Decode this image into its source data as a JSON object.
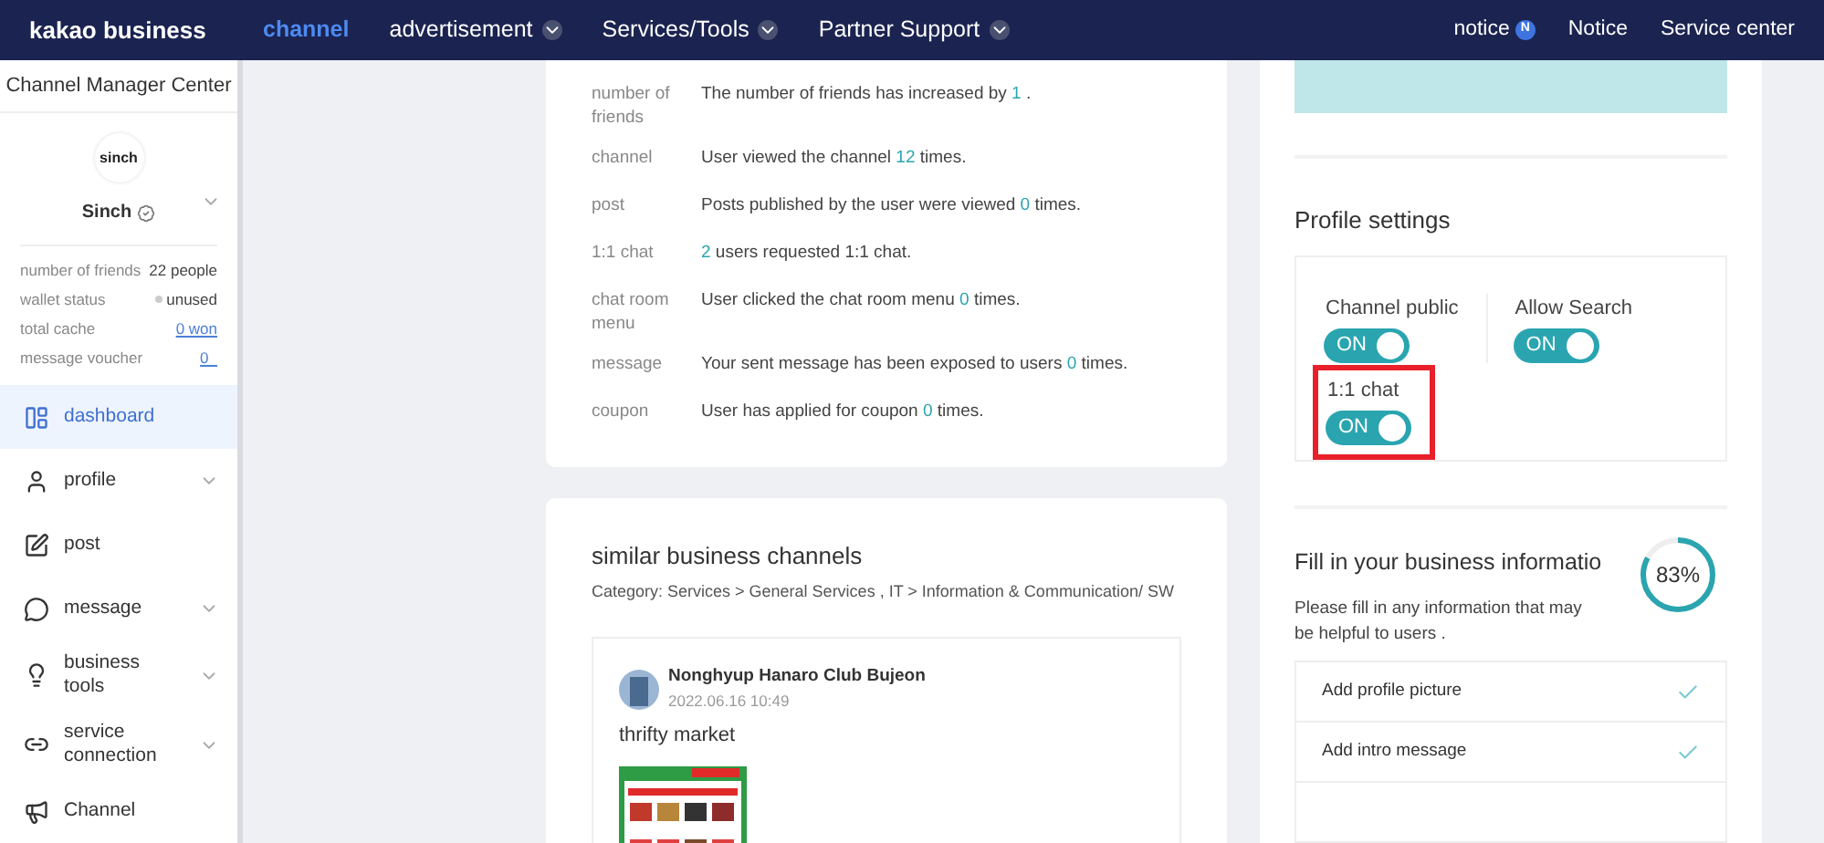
{
  "header": {
    "logo": "kakao business",
    "nav": [
      {
        "label": "channel",
        "selected": true,
        "dropdown": false
      },
      {
        "label": "advertisement",
        "selected": false,
        "dropdown": true
      },
      {
        "label": "Services/Tools",
        "selected": false,
        "dropdown": true
      },
      {
        "label": "Partner Support",
        "selected": false,
        "dropdown": true
      }
    ],
    "notice": {
      "label": "notice",
      "badge": "N"
    },
    "links": [
      "Notice",
      "Service center"
    ]
  },
  "sidebar": {
    "title": "Channel Manager Center",
    "channel": {
      "logo": "sinch",
      "name": "Sinch"
    },
    "stats": [
      {
        "label": "number of friends",
        "value": "22 people",
        "kind": "text"
      },
      {
        "label": "wallet status",
        "value": "unused",
        "kind": "status"
      },
      {
        "label": "total cache",
        "value": "0 won",
        "kind": "link"
      },
      {
        "label": "message voucher",
        "value": "0_",
        "kind": "link"
      }
    ],
    "items": [
      {
        "label": "dashboard",
        "selected": true,
        "dropdown": false
      },
      {
        "label": "profile",
        "selected": false,
        "dropdown": true
      },
      {
        "label": "post",
        "selected": false,
        "dropdown": false
      },
      {
        "label": "message",
        "selected": false,
        "dropdown": true
      },
      {
        "label": "business tools",
        "selected": false,
        "dropdown": true
      },
      {
        "label": "service connection",
        "selected": false,
        "dropdown": true
      },
      {
        "label": "Channel",
        "selected": false,
        "dropdown": false
      }
    ]
  },
  "activity": [
    {
      "label": "number of friends",
      "before": "The number of friends has increased by ",
      "number": "1",
      "after": " ."
    },
    {
      "label": "channel",
      "before": "User viewed the channel ",
      "number": "12",
      "after": " times."
    },
    {
      "label": "post",
      "before": "Posts published by the user were viewed ",
      "number": "0",
      "after": " times."
    },
    {
      "label": "1:1 chat",
      "number": "2",
      "after": " users requested 1:1 chat."
    },
    {
      "label": "chat room menu",
      "before": "User clicked the chat room menu ",
      "number": "0",
      "after": " times."
    },
    {
      "label": "message",
      "before": "Your sent message has been exposed to users ",
      "number": "0",
      "after": " times."
    },
    {
      "label": "coupon",
      "before": "User has applied for coupon ",
      "number": "0",
      "after": " times."
    }
  ],
  "similar": {
    "title": "similar business channels",
    "category": "Category: Services > General Services , IT > Information & Communication/ SW",
    "post": {
      "author": "Nonghyup Hanaro Club Bujeon",
      "date": "2022.06.16 10:49",
      "text": "thrifty market"
    }
  },
  "profile_settings": {
    "title": "Profile settings",
    "toggles": [
      {
        "label": "Channel public",
        "on": true,
        "state_text": "ON",
        "highlighted": false
      },
      {
        "label": "Allow Search",
        "on": true,
        "state_text": "ON",
        "highlighted": false
      },
      {
        "label": "1:1 chat",
        "on": true,
        "state_text": "ON",
        "highlighted": true
      }
    ]
  },
  "business_info": {
    "title": "Fill in your business informatio",
    "progress": {
      "level": 0.83,
      "reading": "83%"
    },
    "description": "Please fill in any information that may be helpful to users .",
    "items": [
      {
        "label": "Add profile picture",
        "checked": true
      },
      {
        "label": "Add intro message",
        "checked": true
      }
    ]
  }
}
